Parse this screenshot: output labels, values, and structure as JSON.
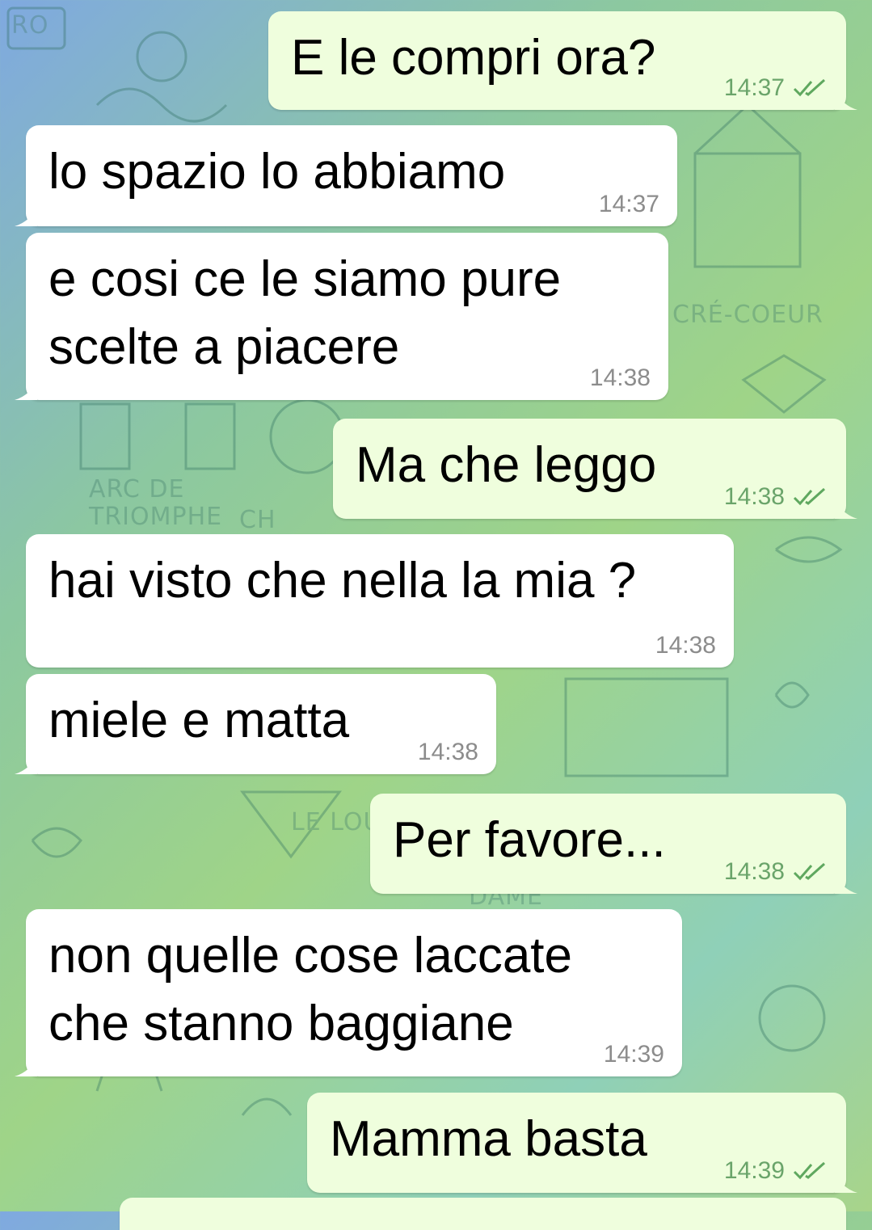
{
  "background_labels": [
    "RO",
    "CRÉ-COEUR",
    "ARC DE",
    "TRIOMPHE",
    "LE LOU",
    "DAME",
    "CH"
  ],
  "colors": {
    "incoming": "#ffffff",
    "outgoing": "#effedd",
    "tick": "#5fa85f"
  },
  "messages": [
    {
      "dir": "out",
      "text": "E le compri ora?",
      "time": "14:37",
      "status": "read"
    },
    {
      "dir": "in",
      "text": "lo spazio lo abbiamo",
      "time": "14:37"
    },
    {
      "dir": "in",
      "text": "e cosi ce le siamo pure\nscelte a piacere",
      "time": "14:38"
    },
    {
      "dir": "out",
      "text": "Ma che leggo",
      "time": "14:38",
      "status": "read"
    },
    {
      "dir": "in",
      "text": "hai visto che nella la mia ?",
      "time": "14:38"
    },
    {
      "dir": "in",
      "text": "miele e matta",
      "time": "14:38"
    },
    {
      "dir": "out",
      "text": "Per favore...",
      "time": "14:38",
      "status": "read"
    },
    {
      "dir": "in",
      "text": "non quelle cose laccate\nche stanno baggiane",
      "time": "14:39"
    },
    {
      "dir": "out",
      "text": "Mamma basta",
      "time": "14:39",
      "status": "read"
    }
  ]
}
